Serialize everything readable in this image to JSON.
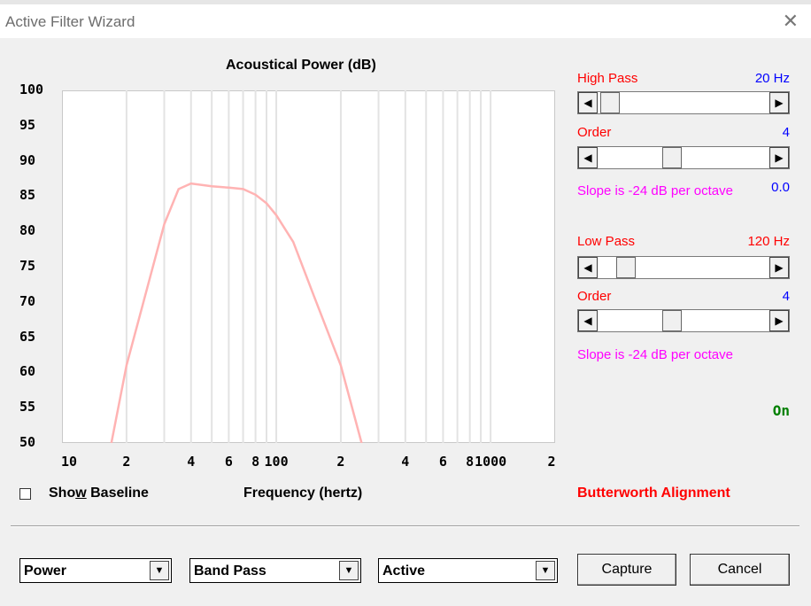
{
  "window": {
    "title": "Active Filter Wizard"
  },
  "chart_data": {
    "type": "line",
    "title": "Acoustical Power (dB)",
    "xlabel": "Frequency (hertz)",
    "ylabel": "",
    "x_scale": "log",
    "xlim": [
      10,
      2000
    ],
    "ylim": [
      50,
      100
    ],
    "y_ticks": [
      "100",
      "95",
      "90",
      "85",
      "80",
      "75",
      "70",
      "65",
      "60",
      "55",
      "50"
    ],
    "x_tick_labels": [
      {
        "value": 10,
        "label": "10"
      },
      {
        "value": 20,
        "label": "2"
      },
      {
        "value": 40,
        "label": "4"
      },
      {
        "value": 60,
        "label": "6"
      },
      {
        "value": 80,
        "label": "8"
      },
      {
        "value": 100,
        "label": "100"
      },
      {
        "value": 200,
        "label": "2"
      },
      {
        "value": 400,
        "label": "4"
      },
      {
        "value": 600,
        "label": "6"
      },
      {
        "value": 800,
        "label": "8"
      },
      {
        "value": 1000,
        "label": "1000"
      },
      {
        "value": 2000,
        "label": "2"
      }
    ],
    "series": [
      {
        "color": "#ffb3b3",
        "x": [
          17,
          20,
          25,
          30,
          35,
          40,
          50,
          60,
          70,
          80,
          90,
          100,
          120,
          150,
          200,
          250
        ],
        "y": [
          50,
          61,
          72,
          81,
          86,
          86.8,
          86.4,
          86.2,
          86.0,
          85.2,
          84.0,
          82.3,
          78.5,
          70.8,
          61.0,
          50
        ]
      }
    ],
    "grid": true
  },
  "baseline": {
    "label_pre": "Sho",
    "label_u": "w",
    "label_post": " Baseline"
  },
  "high_pass": {
    "label": "High Pass",
    "value": "20 Hz",
    "slider": 0.02
  },
  "high_order": {
    "label": "Order",
    "value": "4",
    "slider": 0.42
  },
  "high_slope": {
    "text": "Slope is -24 dB per octave",
    "value": "0.0"
  },
  "low_pass": {
    "label": "Low Pass",
    "value": "120 Hz",
    "slider": 0.12
  },
  "low_order": {
    "label": "Order",
    "value": "4",
    "slider": 0.42
  },
  "low_slope": {
    "text": "Slope is -24 dB per octave"
  },
  "status": {
    "text": "On"
  },
  "alignment": {
    "text": "Butterworth Alignment"
  },
  "combos": {
    "mode": "Power",
    "type": "Band Pass",
    "kind": "Active"
  },
  "buttons": {
    "capture": "Capture",
    "cancel": "Cancel"
  },
  "icons": {
    "close": "close-icon",
    "left": "arrow-left-icon",
    "right": "arrow-right-icon",
    "down": "dropdown-arrow-icon"
  }
}
